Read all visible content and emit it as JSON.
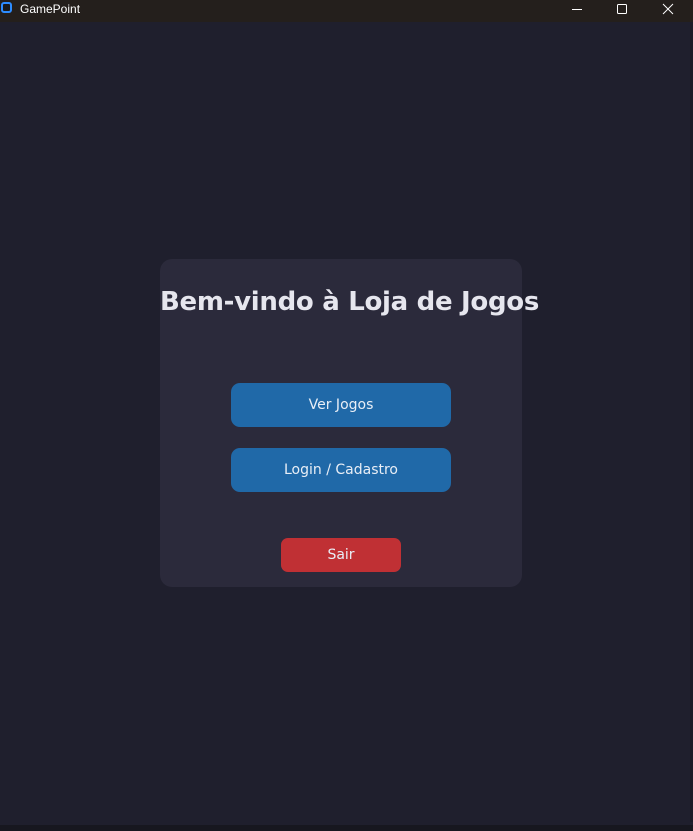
{
  "window": {
    "title": "GamePoint",
    "controls": {
      "minimize_icon": "minimize-icon",
      "maximize_icon": "maximize-icon",
      "close_icon": "close-icon"
    }
  },
  "main": {
    "heading": "Bem-vindo à Loja de Jogos",
    "buttons": {
      "view_games": "Ver Jogos",
      "login_register": "Login / Cadastro",
      "exit": "Sair"
    }
  },
  "colors": {
    "background": "#1f1f2d",
    "card": "#2b2a3b",
    "primary_button": "#2069a8",
    "exit_button": "#c03034",
    "title_bar": "#241f1c"
  }
}
